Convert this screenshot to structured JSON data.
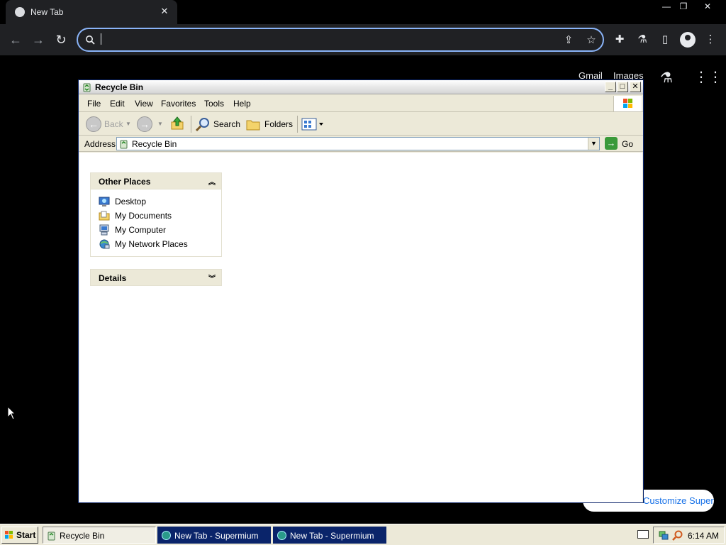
{
  "browser": {
    "tab_title": "New Tab",
    "tab_close": "✕",
    "omnibox_value": "",
    "ntp_links": [
      "Gmail",
      "Images"
    ],
    "customize_label": "Customize Supermium"
  },
  "explorer": {
    "title": "Recycle Bin",
    "menu": [
      "File",
      "Edit",
      "View",
      "Favorites",
      "Tools",
      "Help"
    ],
    "toolbar": {
      "back": "Back",
      "search": "Search",
      "folders": "Folders"
    },
    "address_label": "Address",
    "address_value": "Recycle Bin",
    "go_label": "Go",
    "other_places": {
      "title": "Other Places",
      "items": [
        "Desktop",
        "My Documents",
        "My Computer",
        "My Network Places"
      ]
    },
    "details": {
      "title": "Details"
    }
  },
  "taskbar": {
    "start_label": "Start",
    "items": [
      "Recycle Bin",
      "New Tab - Supermium",
      "New Tab - Supermium"
    ],
    "clock": "6:14 AM"
  }
}
